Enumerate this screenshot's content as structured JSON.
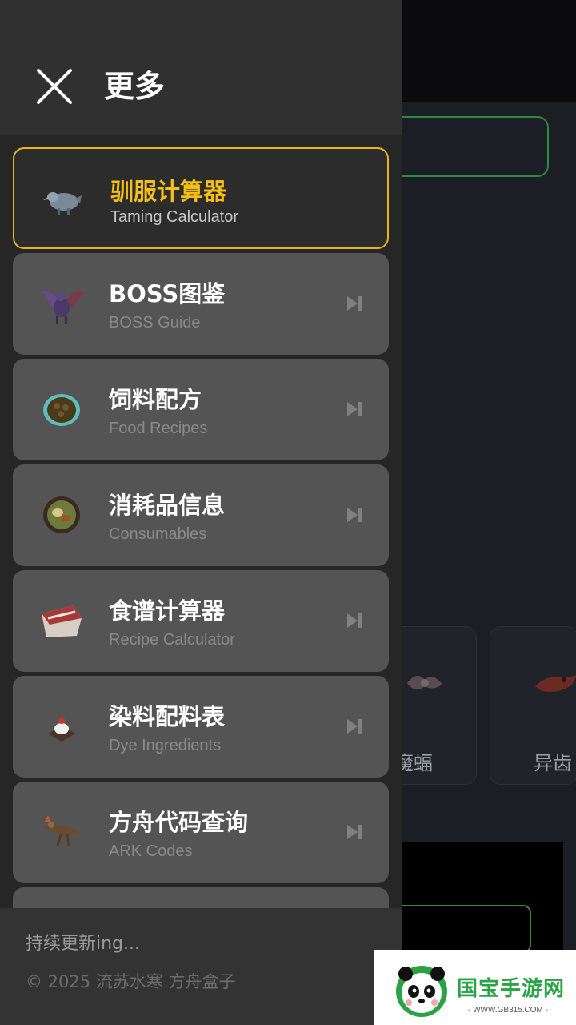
{
  "drawer": {
    "title": "更多",
    "items": [
      {
        "title": "驯服计算器",
        "subtitle": "Taming Calculator",
        "icon": "dodo-creature-icon",
        "active": true
      },
      {
        "title": "BOSS图鉴",
        "subtitle": "BOSS Guide",
        "icon": "dragon-boss-icon"
      },
      {
        "title": "饲料配方",
        "subtitle": "Food Recipes",
        "icon": "kibble-egg-icon"
      },
      {
        "title": "消耗品信息",
        "subtitle": "Consumables",
        "icon": "soup-bowl-icon"
      },
      {
        "title": "食谱计算器",
        "subtitle": "Recipe Calculator",
        "icon": "meat-cut-icon"
      },
      {
        "title": "染料配料表",
        "subtitle": "Dye Ingredients",
        "icon": "dye-bowl-icon"
      },
      {
        "title": "方舟代码查询",
        "subtitle": "ARK Codes",
        "icon": "raptor-icon"
      }
    ],
    "footer": {
      "status": "持续更新ing...",
      "copyright": "© 2025 流苏水寒 方舟盒子"
    }
  },
  "background": {
    "cards": [
      {
        "name": "魔蝠"
      },
      {
        "name": "异齿"
      }
    ]
  },
  "watermark": {
    "brand": "国宝手游网",
    "url": "- WWW.GB315.COM -"
  },
  "colors": {
    "accent": "#f5bf16",
    "drawer_bg": "#2f2f30",
    "item_bg": "#545454",
    "watermark_green": "#2aa345"
  }
}
